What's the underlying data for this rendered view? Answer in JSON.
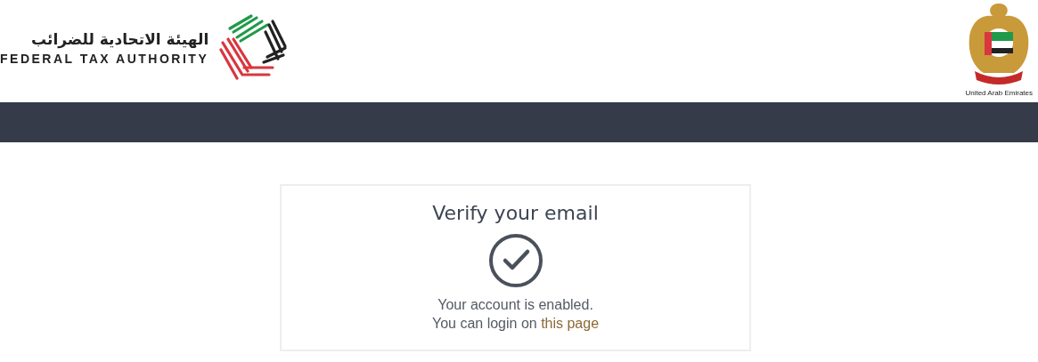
{
  "header": {
    "org_name_ar": "الهيئة الاتحادية للضرائب",
    "org_name_en": "FEDERAL TAX AUTHORITY",
    "emblem_caption": "United Arab Emirates"
  },
  "card": {
    "title": "Verify your email",
    "message": "Your account is enabled.",
    "login_prefix": "You can login on",
    "login_link": "this page"
  }
}
